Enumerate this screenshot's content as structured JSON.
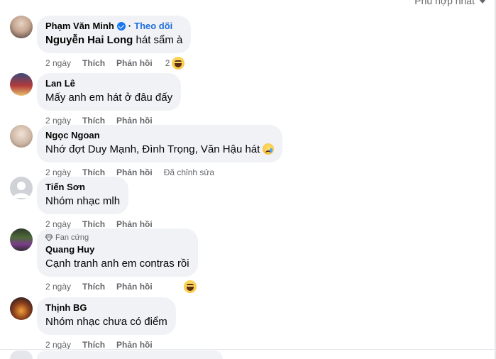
{
  "sort": {
    "label": "Phù hợp nhất"
  },
  "comments": [
    {
      "author": "Phạm Văn Minh",
      "verified": true,
      "follow": "Theo dõi",
      "mention": "Nguyễn Hai Long",
      "text": " hát sẩm à",
      "time": "2 ngày",
      "like": "Thích",
      "reply": "Phản hồi",
      "reaction_count": "2",
      "reaction": "laugh-emoji"
    },
    {
      "author": "Lan Lê",
      "text": "Mấy anh em hát ở đâu đấy",
      "time": "2 ngày",
      "like": "Thích",
      "reply": "Phản hồi"
    },
    {
      "author": "Ngọc Ngoan",
      "text": "Nhớ đợt Duy Mạnh, Đình Trọng, Văn Hậu hát",
      "text_emoji": "sad-tear-emoji",
      "time": "2 ngày",
      "like": "Thích",
      "reply": "Phản hồi",
      "edited": "Đã chỉnh sửa"
    },
    {
      "author": "Tiến Sơn",
      "text": "Nhóm nhạc mlh",
      "time": "2 ngày",
      "like": "Thích",
      "reply": "Phản hồi"
    },
    {
      "badge": "Fan cứng",
      "author": "Quang Huy",
      "text": "Cạnh tranh anh em contras rồi",
      "time": "2 ngày",
      "like": "Thích",
      "reply": "Phản hồi",
      "reaction": "laugh-emoji"
    },
    {
      "author": "Thịnh BG",
      "text": "Nhóm nhạc chưa có điểm",
      "time": "2 ngày",
      "like": "Thích",
      "reply": "Phản hồi"
    }
  ],
  "colors": {
    "bubble": "#f0f2f5",
    "meta_text": "#65676b",
    "follow_link": "#216fdb",
    "verified": "#1877f2"
  }
}
